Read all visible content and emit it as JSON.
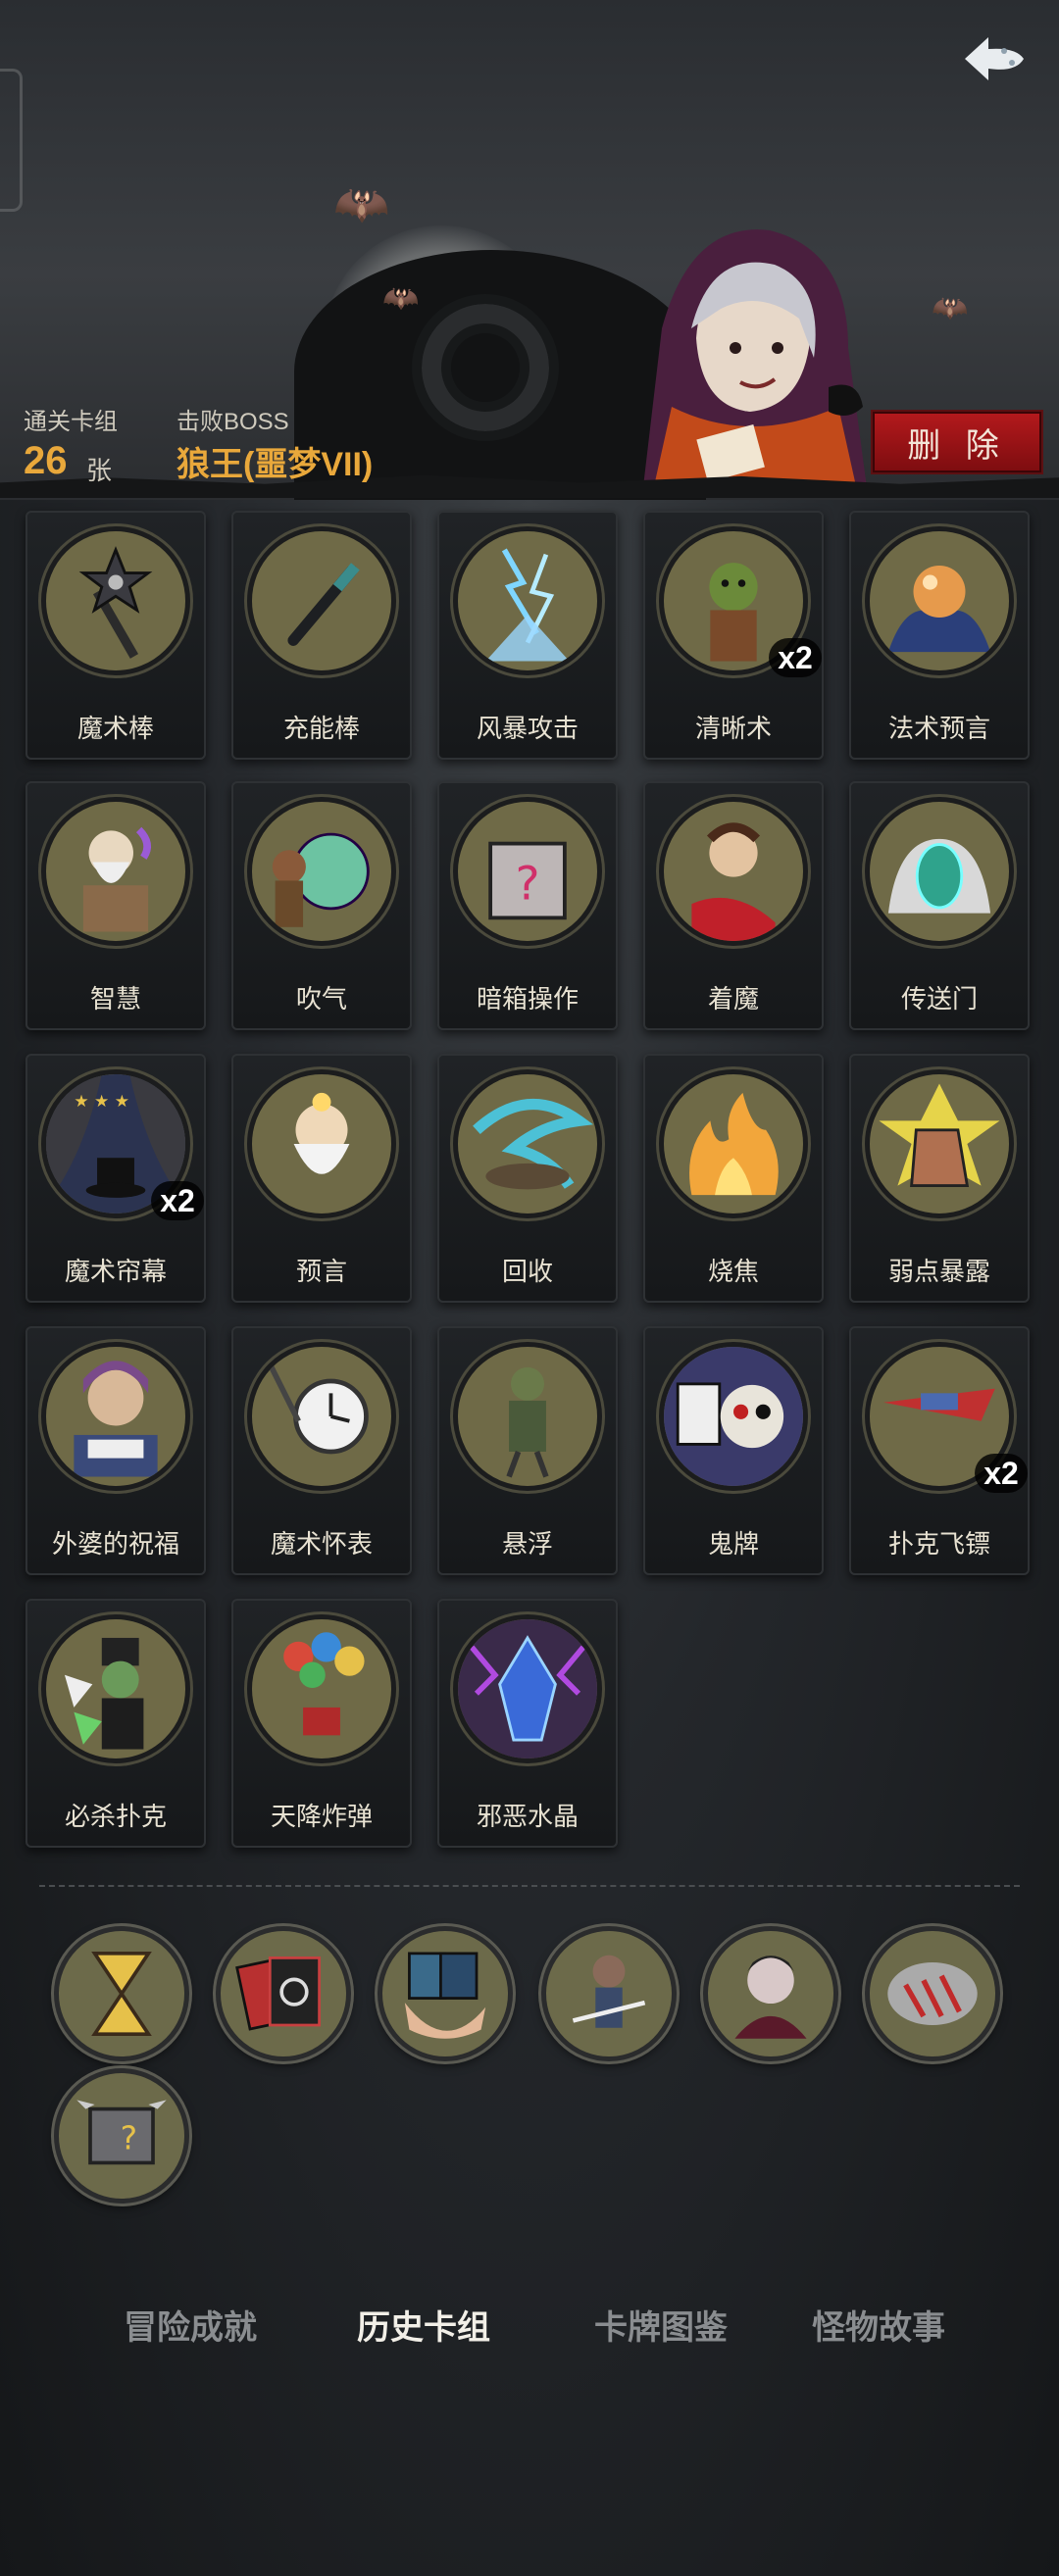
{
  "header": {
    "cleared_deck_label": "通关卡组",
    "card_count": "26",
    "card_unit": "张",
    "boss_label": "击败BOSS",
    "boss_name": "狼王(噩梦VII)",
    "delete_label": "删 除"
  },
  "cards": [
    {
      "name": "魔术棒",
      "icon": "star-wand-icon"
    },
    {
      "name": "充能棒",
      "icon": "charged-rod-icon"
    },
    {
      "name": "风暴攻击",
      "icon": "storm-icon"
    },
    {
      "name": "清晰术",
      "icon": "goblin-icon",
      "count": "x2"
    },
    {
      "name": "法术预言",
      "icon": "crystal-ball-icon"
    },
    {
      "name": "智慧",
      "icon": "old-sage-icon"
    },
    {
      "name": "吹气",
      "icon": "bubble-icon"
    },
    {
      "name": "暗箱操作",
      "icon": "mystery-box-icon"
    },
    {
      "name": "着魔",
      "icon": "possessed-man-icon"
    },
    {
      "name": "传送门",
      "icon": "portal-icon"
    },
    {
      "name": "魔术帘幕",
      "icon": "curtain-hat-icon",
      "count": "x2"
    },
    {
      "name": "预言",
      "icon": "prophet-icon"
    },
    {
      "name": "回收",
      "icon": "swirl-icon"
    },
    {
      "name": "烧焦",
      "icon": "fire-icon"
    },
    {
      "name": "弱点暴露",
      "icon": "boot-icon"
    },
    {
      "name": "外婆的祝福",
      "icon": "grandma-icon"
    },
    {
      "name": "魔术怀表",
      "icon": "pocket-watch-icon"
    },
    {
      "name": "悬浮",
      "icon": "levitate-icon"
    },
    {
      "name": "鬼牌",
      "icon": "skull-card-icon"
    },
    {
      "name": "扑克飞镖",
      "icon": "card-dart-icon",
      "count": "x2"
    },
    {
      "name": "必杀扑克",
      "icon": "dealer-icon"
    },
    {
      "name": "天降炸弹",
      "icon": "balloon-bomb-icon"
    },
    {
      "name": "邪恶水晶",
      "icon": "evil-crystal-icon"
    }
  ],
  "relics": [
    {
      "icon": "hourglass-icon"
    },
    {
      "icon": "spiral-cards-icon"
    },
    {
      "icon": "hand-cards-icon"
    },
    {
      "icon": "knife-juggler-icon"
    },
    {
      "icon": "vampire-icon"
    },
    {
      "icon": "claw-cloud-icon"
    },
    {
      "icon": "spiked-box-icon"
    }
  ],
  "tabs": [
    {
      "label": "冒险成就",
      "active": false
    },
    {
      "label": "历史卡组",
      "active": true
    },
    {
      "label": "卡牌图鉴",
      "active": false
    },
    {
      "label": "怪物故事",
      "active": false
    }
  ]
}
